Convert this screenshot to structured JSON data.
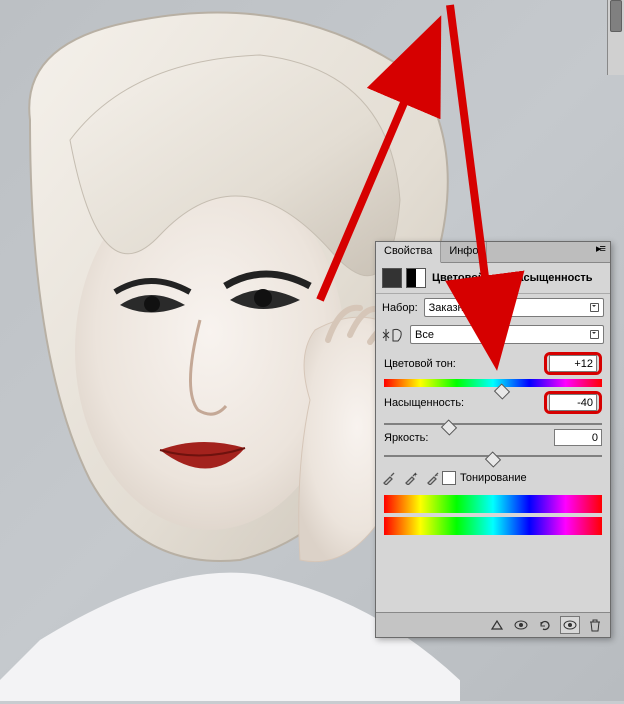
{
  "tabs": {
    "properties": "Свойства",
    "info": "Инфо"
  },
  "panel": {
    "title": "Цветовой тон/Насыщенность",
    "preset_label": "Набор:",
    "preset_value": "Заказная",
    "channel_value": "Все",
    "hue_label": "Цветовой тон:",
    "hue_value": "+12",
    "sat_label": "Насыщенность:",
    "sat_value": "-40",
    "lig_label": "Яркость:",
    "lig_value": "0",
    "colorize_label": "Тонирование"
  }
}
